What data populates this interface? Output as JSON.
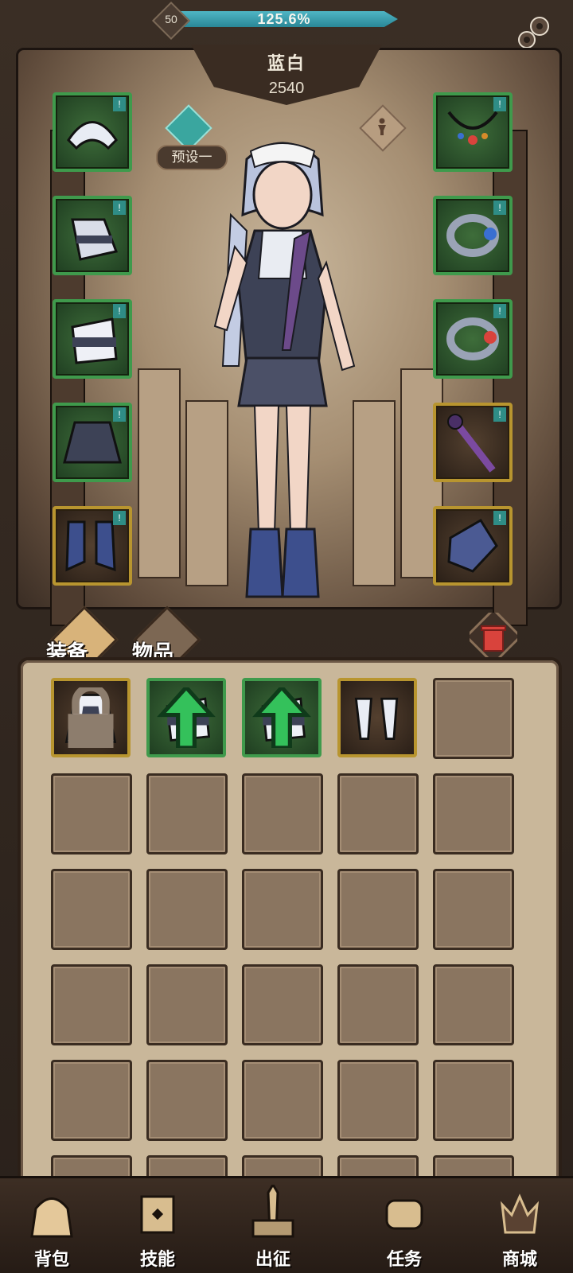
{
  "header": {
    "level": "50",
    "xp_percent_label": "125.6%",
    "xp_fill_fraction": 1.0
  },
  "character": {
    "name": "蓝白",
    "power": "2540",
    "preset_label": "预设一"
  },
  "equipment_left": [
    {
      "slot": "headwear",
      "frame": "green"
    },
    {
      "slot": "gloves",
      "frame": "green"
    },
    {
      "slot": "armband",
      "frame": "green"
    },
    {
      "slot": "skirt",
      "frame": "green"
    },
    {
      "slot": "boots",
      "frame": "gold"
    }
  ],
  "equipment_right": [
    {
      "slot": "necklace",
      "frame": "green"
    },
    {
      "slot": "ring-1",
      "frame": "green"
    },
    {
      "slot": "ring-2",
      "frame": "green"
    },
    {
      "slot": "staff",
      "frame": "gold"
    },
    {
      "slot": "offhand",
      "frame": "gold"
    }
  ],
  "bag_tabs": {
    "equipment": "装备",
    "items": "物品"
  },
  "bag_items": [
    {
      "kind": "maid-dress",
      "frame": "gold",
      "locked": true,
      "upgrade": false
    },
    {
      "kind": "armband",
      "frame": "green",
      "locked": false,
      "upgrade": true
    },
    {
      "kind": "armband",
      "frame": "green",
      "locked": false,
      "upgrade": true
    },
    {
      "kind": "heels",
      "frame": "gold",
      "locked": false,
      "upgrade": false
    }
  ],
  "bottom_nav": [
    {
      "label": "背包",
      "icon": "backpack-icon"
    },
    {
      "label": "技能",
      "icon": "skill-book-icon"
    },
    {
      "label": "出征",
      "icon": "expedition-sword-icon"
    },
    {
      "label": "任务",
      "icon": "quest-scroll-icon"
    },
    {
      "label": "商城",
      "icon": "shop-crown-icon"
    }
  ],
  "colors": {
    "xp_bar": "#2a8797",
    "rare_frame": "#3f9a4c",
    "epic_frame": "#b8952f",
    "trash": "#d9433c"
  }
}
